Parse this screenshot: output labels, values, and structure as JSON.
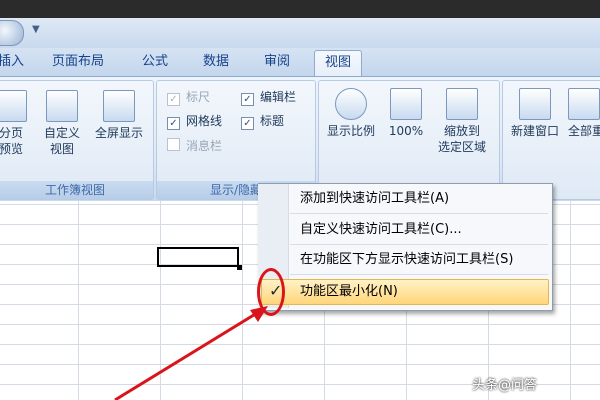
{
  "colors": {
    "accent": "#15428b",
    "annotation": "#d9151b",
    "highlight": "#ffd67a"
  },
  "tabs": [
    {
      "label": "插入"
    },
    {
      "label": "页面布局"
    },
    {
      "label": "公式"
    },
    {
      "label": "数据"
    },
    {
      "label": "审阅"
    },
    {
      "label": "视图"
    }
  ],
  "ribbon": {
    "workbook_views": {
      "label": "工作簿视图",
      "page_break_label_line1": "分页",
      "page_break_label_line2": "预览",
      "custom_view_line1": "自定义",
      "custom_view_line2": "视图",
      "full_screen_label": "全屏显示"
    },
    "show_hide": {
      "label": "显示/隐藏",
      "ruler": {
        "label": "标尺",
        "checked": true,
        "enabled": false
      },
      "formula_bar": {
        "label": "编辑栏",
        "checked": true,
        "enabled": true
      },
      "gridlines": {
        "label": "网格线",
        "checked": true,
        "enabled": true
      },
      "headings": {
        "label": "标题",
        "checked": true,
        "enabled": true
      },
      "message_bar": {
        "label": "消息栏",
        "checked": false,
        "enabled": false
      }
    },
    "zoom": {
      "zoom_label": "显示比例",
      "hundred_label": "100%",
      "zoom_sel_line1": "缩放到",
      "zoom_sel_line2": "选定区域"
    },
    "window": {
      "new_window_label": "新建窗口",
      "arrange_all_label": "全部重"
    }
  },
  "context_menu": {
    "items": [
      {
        "label": "添加到快速访问工具栏(A)"
      },
      {
        "label": "自定义快速访问工具栏(C)..."
      },
      {
        "label": "在功能区下方显示快速访问工具栏(S)"
      },
      {
        "label": "功能区最小化(N)",
        "checked": true,
        "highlighted": true
      }
    ],
    "check_mark": "✓"
  },
  "watermark": "头条@问答"
}
